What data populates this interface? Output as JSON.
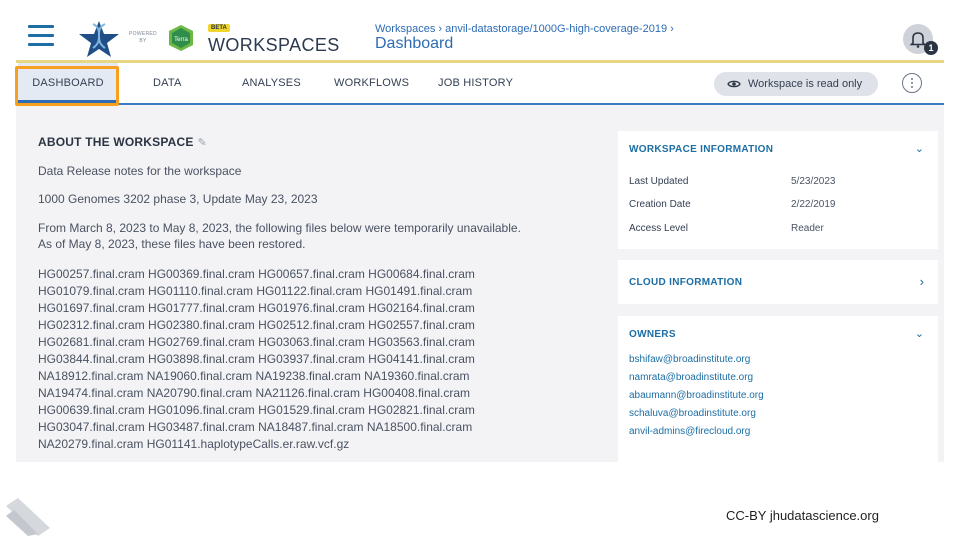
{
  "header": {
    "powered_by_line1": "POWERED",
    "powered_by_line2": "BY",
    "terra_label": "Terra",
    "beta_badge": "BETA",
    "brand": "WORKSPACES",
    "breadcrumb": "Workspaces › anvil-datastorage/1000G-high-coverage-2019 ›",
    "page_title": "Dashboard",
    "notification_count": "1"
  },
  "tabs": [
    {
      "label": "DASHBOARD",
      "active": true
    },
    {
      "label": "DATA",
      "active": false
    },
    {
      "label": "ANALYSES",
      "active": false
    },
    {
      "label": "WORKFLOWS",
      "active": false
    },
    {
      "label": "JOB HISTORY",
      "active": false
    }
  ],
  "readonly_pill": "Workspace is read only",
  "about": {
    "title": "ABOUT THE WORKSPACE",
    "line1": "Data Release notes for the workspace",
    "line2": "1000 Genomes 3202 phase 3, Update May 23, 2023",
    "line3a": "From March 8, 2023 to May 8, 2023, the following files below were temporarily unavailable.",
    "line3b": "As of May 8, 2023, these files have been restored.",
    "file_lines": [
      "HG00257.final.cram HG00369.final.cram HG00657.final.cram HG00684.final.cram",
      "HG01079.final.cram HG01110.final.cram HG01122.final.cram HG01491.final.cram",
      "HG01697.final.cram HG01777.final.cram HG01976.final.cram HG02164.final.cram",
      "HG02312.final.cram HG02380.final.cram HG02512.final.cram HG02557.final.cram",
      "HG02681.final.cram HG02769.final.cram HG03063.final.cram HG03563.final.cram",
      "HG03844.final.cram HG03898.final.cram HG03937.final.cram HG04141.final.cram",
      "NA18912.final.cram NA19060.final.cram NA19238.final.cram NA19360.final.cram",
      "NA19474.final.cram NA20790.final.cram NA21126.final.cram HG00408.final.cram",
      "HG00639.final.cram HG01096.final.cram HG01529.final.cram HG02821.final.cram",
      "HG03047.final.cram HG03487.final.cram NA18487.final.cram NA18500.final.cram",
      "NA20279.final.cram HG01141.haplotypeCalls.er.raw.vcf.gz"
    ]
  },
  "workspace_info": {
    "title": "WORKSPACE INFORMATION",
    "rows": [
      {
        "label": "Last Updated",
        "value": "5/23/2023"
      },
      {
        "label": "Creation Date",
        "value": "2/22/2019"
      },
      {
        "label": "Access Level",
        "value": "Reader"
      }
    ]
  },
  "cloud_info": {
    "title": "CLOUD INFORMATION"
  },
  "owners": {
    "title": "OWNERS",
    "emails": [
      "bshifaw@broadinstitute.org",
      "namrata@broadinstitute.org",
      "abaumann@broadinstitute.org",
      "schaluva@broadinstitute.org",
      "anvil-admins@firecloud.org"
    ]
  },
  "footer": {
    "credit": "CC-BY  jhudatascience.org"
  },
  "colors": {
    "accent": "#2d6cb4",
    "highlight": "#f7a020",
    "header_rule": "#e7d684"
  }
}
